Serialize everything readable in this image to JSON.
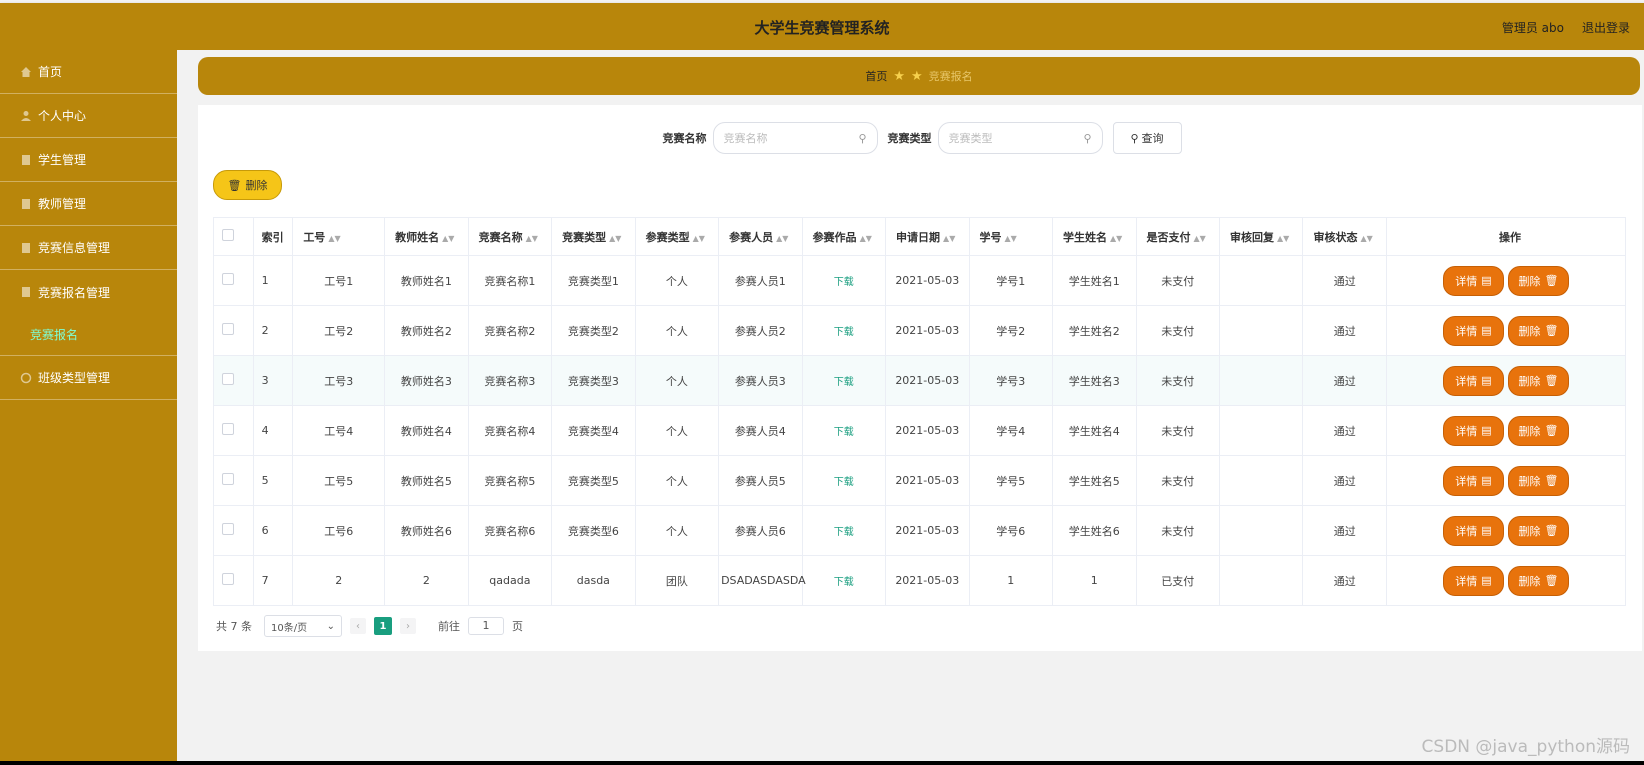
{
  "header": {
    "title": "大学生竞赛管理系统",
    "user_label": "管理员 abo",
    "logout_label": "退出登录"
  },
  "sidebar": {
    "items": [
      {
        "label": "首页",
        "icon": "home-icon"
      },
      {
        "label": "个人中心",
        "icon": "user-icon"
      },
      {
        "label": "学生管理",
        "icon": "doc-icon"
      },
      {
        "label": "教师管理",
        "icon": "doc-icon"
      },
      {
        "label": "竞赛信息管理",
        "icon": "doc-icon"
      },
      {
        "label": "竞赛报名管理",
        "icon": "doc-icon"
      },
      {
        "label": "竞赛报名",
        "icon": ""
      },
      {
        "label": "班级类型管理",
        "icon": "doc-icon"
      }
    ]
  },
  "breadcrumb": {
    "home": "首页",
    "current": "竞赛报名"
  },
  "search": {
    "name_label": "竞赛名称",
    "name_placeholder": "竞赛名称",
    "type_label": "竞赛类型",
    "type_placeholder": "竞赛类型",
    "query_label": "查询"
  },
  "toolbar": {
    "delete_label": "删除"
  },
  "table": {
    "headers": [
      "索引",
      "工号",
      "教师姓名",
      "竞赛名称",
      "竞赛类型",
      "参赛类型",
      "参赛人员",
      "参赛作品",
      "申请日期",
      "学号",
      "学生姓名",
      "是否支付",
      "审核回复",
      "审核状态",
      "操作"
    ],
    "rows": [
      [
        "1",
        "工号1",
        "教师姓名1",
        "竞赛名称1",
        "竞赛类型1",
        "个人",
        "参赛人员1",
        "下载",
        "2021-05-03",
        "学号1",
        "学生姓名1",
        "未支付",
        "",
        "通过"
      ],
      [
        "2",
        "工号2",
        "教师姓名2",
        "竞赛名称2",
        "竞赛类型2",
        "个人",
        "参赛人员2",
        "下载",
        "2021-05-03",
        "学号2",
        "学生姓名2",
        "未支付",
        "",
        "通过"
      ],
      [
        "3",
        "工号3",
        "教师姓名3",
        "竞赛名称3",
        "竞赛类型3",
        "个人",
        "参赛人员3",
        "下载",
        "2021-05-03",
        "学号3",
        "学生姓名3",
        "未支付",
        "",
        "通过"
      ],
      [
        "4",
        "工号4",
        "教师姓名4",
        "竞赛名称4",
        "竞赛类型4",
        "个人",
        "参赛人员4",
        "下载",
        "2021-05-03",
        "学号4",
        "学生姓名4",
        "未支付",
        "",
        "通过"
      ],
      [
        "5",
        "工号5",
        "教师姓名5",
        "竞赛名称5",
        "竞赛类型5",
        "个人",
        "参赛人员5",
        "下载",
        "2021-05-03",
        "学号5",
        "学生姓名5",
        "未支付",
        "",
        "通过"
      ],
      [
        "6",
        "工号6",
        "教师姓名6",
        "竞赛名称6",
        "竞赛类型6",
        "个人",
        "参赛人员6",
        "下载",
        "2021-05-03",
        "学号6",
        "学生姓名6",
        "未支付",
        "",
        "通过"
      ],
      [
        "7",
        "2",
        "2",
        "qadada",
        "dasda",
        "团队",
        "DSADASDASDA",
        "下载",
        "2021-05-03",
        "1",
        "1",
        "已支付",
        "",
        "通过"
      ]
    ],
    "detail_label": "详情",
    "delete_label": "删除"
  },
  "pagination": {
    "total": "共 7 条",
    "page_size": "10条/页",
    "current_page": "1",
    "goto_prefix": "前往",
    "goto_value": "1",
    "goto_suffix": "页"
  },
  "watermark": "CSDN @java_python源码",
  "colors": {
    "primary": "#b8860b",
    "action": "#e8730c",
    "accent": "#199e7f",
    "delete_button": "#f5c518"
  }
}
